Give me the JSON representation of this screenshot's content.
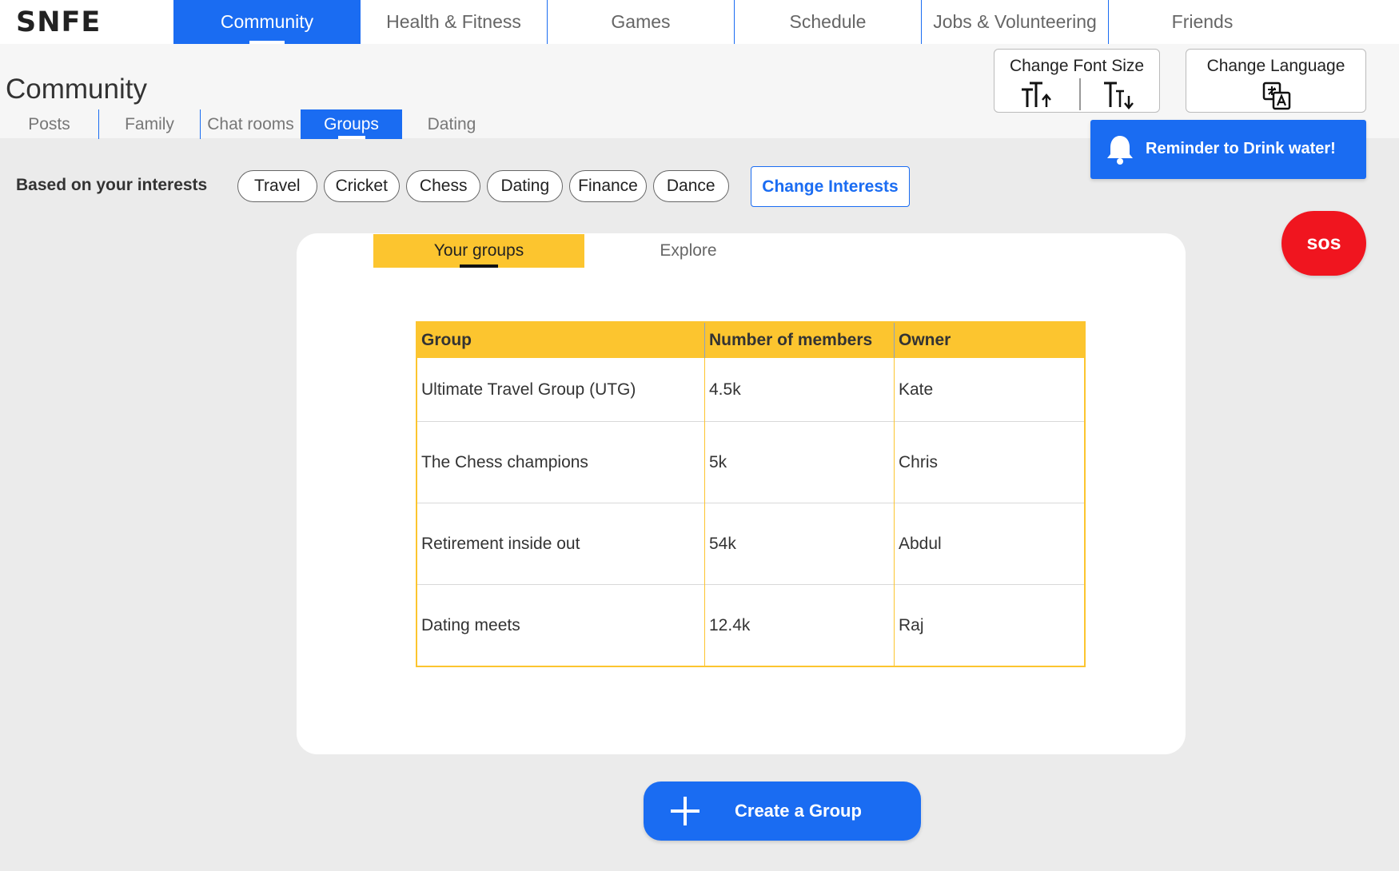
{
  "app": {
    "logo": "SNFE"
  },
  "nav": {
    "tabs": [
      {
        "label": "Community",
        "active": true
      },
      {
        "label": "Health & Fitness"
      },
      {
        "label": "Games"
      },
      {
        "label": "Schedule"
      },
      {
        "label": "Jobs & Volunteering"
      },
      {
        "label": "Friends"
      }
    ]
  },
  "page": {
    "title": "Community"
  },
  "subnav": {
    "tabs": [
      {
        "label": "Posts"
      },
      {
        "label": "Family"
      },
      {
        "label": "Chat rooms"
      },
      {
        "label": "Groups",
        "active": true
      },
      {
        "label": "Dating"
      }
    ]
  },
  "utilities": {
    "font_size_label": "Change Font Size",
    "language_label": "Change Language",
    "reminder": "Reminder to Drink water!",
    "sos": "sos"
  },
  "interests": {
    "label": "Based on your interests",
    "chips": [
      "Travel",
      "Cricket",
      "Chess",
      "Dating",
      "Finance",
      "Dance"
    ],
    "change_button": "Change Interests"
  },
  "groups_card": {
    "tabs": [
      {
        "label": "Your groups",
        "active": true
      },
      {
        "label": "Explore"
      }
    ],
    "table": {
      "headers": [
        "Group",
        "Number of members",
        "Owner"
      ],
      "rows": [
        [
          "Ultimate Travel Group (UTG)",
          "4.5k",
          "Kate"
        ],
        [
          "The Chess champions",
          "5k",
          "Chris"
        ],
        [
          "Retirement inside out",
          "54k",
          "Abdul"
        ],
        [
          "Dating meets",
          "12.4k",
          "Raj"
        ]
      ]
    }
  },
  "create_button": "Create a Group",
  "colors": {
    "primary": "#1a6cf2",
    "accent_yellow": "#fcc52f",
    "sos_red": "#f0151f",
    "background": "#ebebeb"
  },
  "icons": [
    "font-increase-icon",
    "font-decrease-icon",
    "translate-icon",
    "bell-icon",
    "plus-icon"
  ]
}
